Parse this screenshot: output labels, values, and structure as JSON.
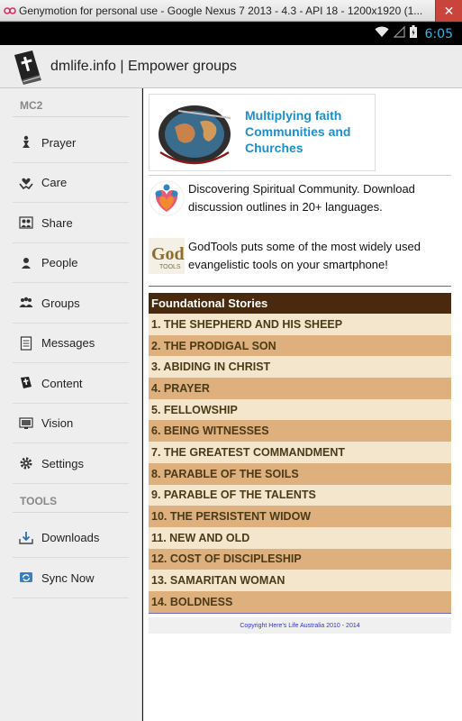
{
  "window": {
    "title": "Genymotion for personal use - Google Nexus 7 2013 - 4.3 - API 18 - 1200x1920 (1...",
    "close_label": "✕"
  },
  "status_bar": {
    "time": "6:05",
    "time_color": "#33b5e5"
  },
  "action_bar": {
    "title": "dmlife.info | Empower groups",
    "icon": "bible-icon"
  },
  "drawer": {
    "section1": "MC2",
    "items": [
      {
        "label": "Prayer",
        "icon": "praying-person-icon"
      },
      {
        "label": "Care",
        "icon": "care-hands-icon"
      },
      {
        "label": "Share",
        "icon": "share-people-icon"
      },
      {
        "label": "People",
        "icon": "person-icon"
      },
      {
        "label": "Groups",
        "icon": "group-icon"
      },
      {
        "label": "Messages",
        "icon": "document-icon"
      },
      {
        "label": "Content",
        "icon": "bible-icon"
      },
      {
        "label": "Vision",
        "icon": "monitor-icon"
      },
      {
        "label": "Settings",
        "icon": "gear-icon"
      }
    ],
    "section2": "TOOLS",
    "tools": [
      {
        "label": "Downloads",
        "icon": "download-icon"
      },
      {
        "label": "Sync Now",
        "icon": "sync-icon"
      }
    ]
  },
  "main": {
    "banner": {
      "text": "Multiplying faith Communities and Churches",
      "accent_color": "#1e8fc9"
    },
    "promos": [
      {
        "text": "Discovering Spiritual Community. Download discussion outlines in 20+ languages.",
        "icon": "heart-people-icon"
      },
      {
        "text": "GodTools puts some of the most widely used evangelistic tools on your smartphone!",
        "icon": "godtools-logo"
      }
    ],
    "stories": {
      "header": "Foundational Stories",
      "header_color": "#4a2a0e",
      "row_colors": [
        "#f3e6cd",
        "#ddb07e"
      ],
      "items": [
        "1. THE SHEPHERD AND HIS SHEEP",
        "2. THE PRODIGAL SON",
        "3. ABIDING IN CHRIST",
        "4. PRAYER",
        "5. FELLOWSHIP",
        "6. BEING WITNESSES",
        "7. THE GREATEST COMMANDMENT",
        "8. PARABLE OF THE SOILS",
        "9. PARABLE OF THE TALENTS",
        "10. THE PERSISTENT WIDOW",
        "11. NEW AND OLD",
        "12. COST OF DISCIPLESHIP",
        "13. SAMARITAN WOMAN",
        "14. BOLDNESS"
      ]
    },
    "copyright": "Copyright Here's Life Australia 2010 - 2014"
  }
}
